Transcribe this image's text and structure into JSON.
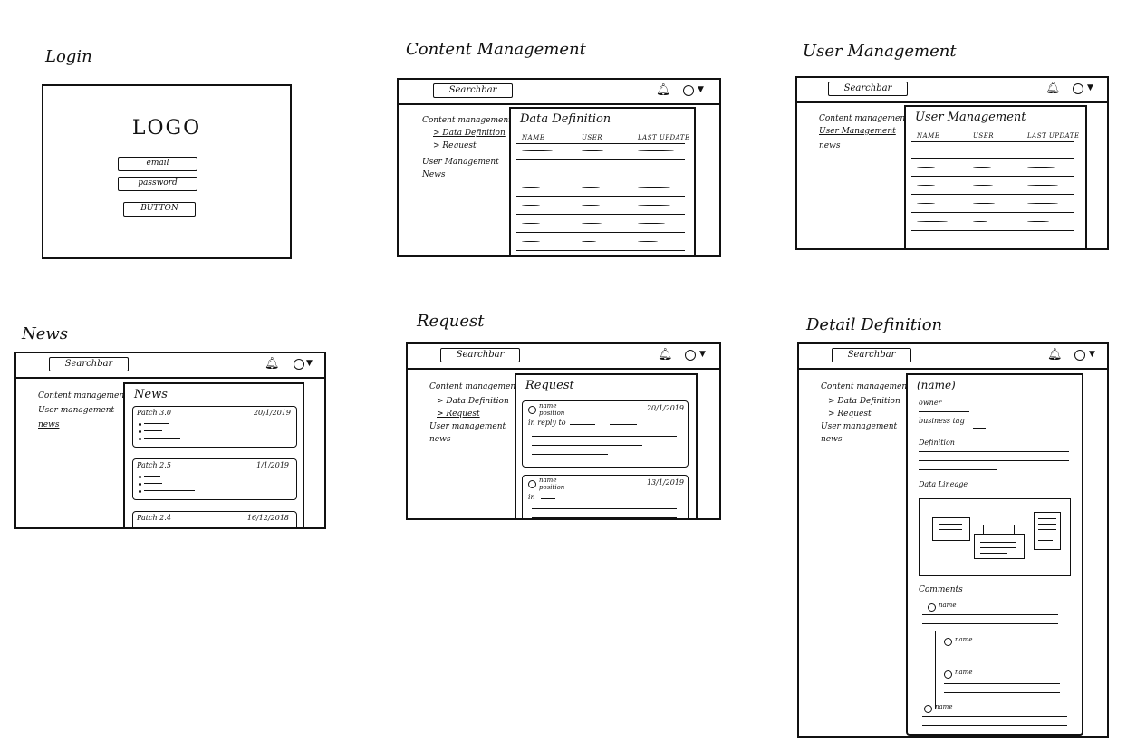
{
  "screens": {
    "login": {
      "title": "Login",
      "logo": "LOGO",
      "email_placeholder": "email",
      "password_placeholder": "password",
      "button_label": "BUTTON"
    },
    "content_management": {
      "title": "Content Management",
      "search": "Searchbar",
      "nav": [
        "Content management",
        "> Data Definition",
        "> Request",
        "User Management",
        "News"
      ],
      "panel_title": "Data Definition",
      "columns": [
        "NAME",
        "USER",
        "LAST UPDATE"
      ]
    },
    "user_management": {
      "title": "User Management",
      "search": "Searchbar",
      "nav": [
        "Content management",
        "User Management",
        "news"
      ],
      "panel_title": "User Management",
      "columns": [
        "NAME",
        "USER",
        "LAST UPDATE"
      ]
    },
    "news": {
      "title": "News",
      "search": "Searchbar",
      "nav": [
        "Content management",
        "User management",
        "news"
      ],
      "panel_title": "News",
      "cards": [
        {
          "title": "Patch 3.0",
          "date": "20/1/2019"
        },
        {
          "title": "Patch 2.5",
          "date": "1/1/2019"
        },
        {
          "title": "Patch 2.4",
          "date": "16/12/2018"
        }
      ]
    },
    "request": {
      "title": "Request",
      "search": "Searchbar",
      "nav": [
        "Content management",
        "> Data Definition",
        "> Request",
        "User management",
        "news"
      ],
      "panel_title": "Request",
      "cards": [
        {
          "name": "name",
          "position": "position",
          "date": "20/1/2019",
          "line": "in reply to"
        },
        {
          "name": "name",
          "position": "position",
          "date": "13/1/2019",
          "line": "in"
        }
      ]
    },
    "detail_definition": {
      "title": "Detail Definition",
      "search": "Searchbar",
      "nav": [
        "Content management",
        "> Data Definition",
        "> Request",
        "User management",
        "news"
      ],
      "heading": "(name)",
      "owner": "owner",
      "business_tag": "business tag",
      "definition_label": "Definition",
      "lineage_label": "Data Lineage",
      "comments_label": "Comments",
      "comment_names": [
        "name",
        "name",
        "name",
        "name"
      ]
    }
  },
  "icons": {
    "bell": "bell-icon",
    "user": "user-circle-icon",
    "caret": "caret-down-icon"
  }
}
